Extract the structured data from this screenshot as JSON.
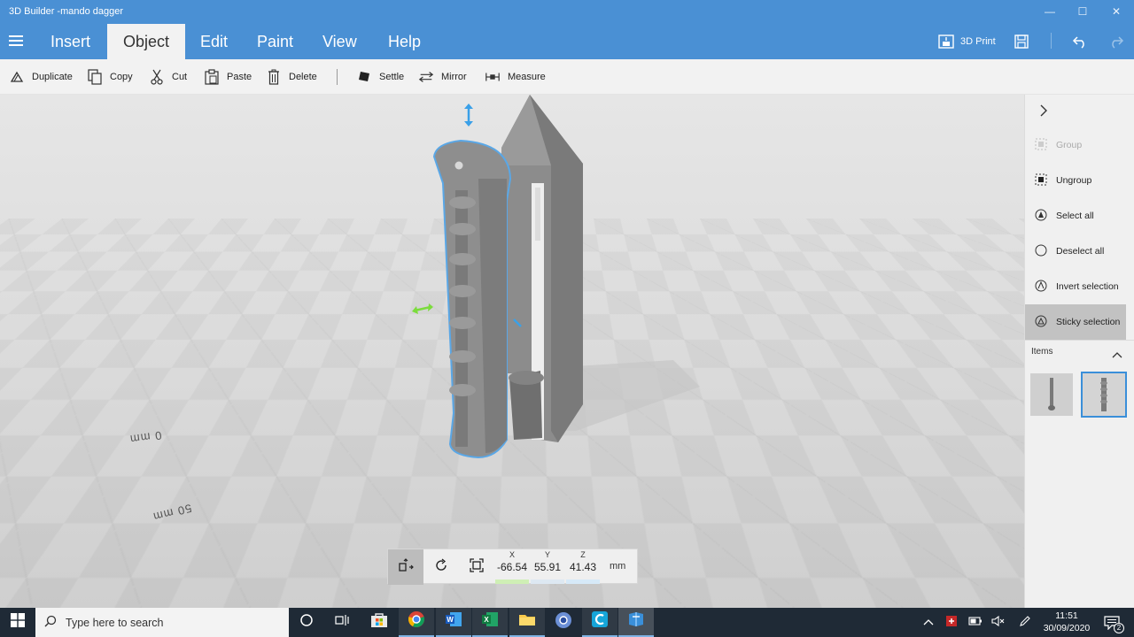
{
  "window": {
    "title": "3D Builder -mando dagger",
    "controls": [
      "—",
      "☐",
      "✕"
    ]
  },
  "menu": {
    "tabs": [
      "Insert",
      "Object",
      "Edit",
      "Paint",
      "View",
      "Help"
    ],
    "active_tab": "Object",
    "print_label": "3D Print"
  },
  "ribbon": {
    "duplicate": "Duplicate",
    "copy": "Copy",
    "cut": "Cut",
    "paste": "Paste",
    "delete": "Delete",
    "settle": "Settle",
    "mirror": "Mirror",
    "measure": "Measure"
  },
  "viewport": {
    "scale_label_0": "0 mm",
    "scale_label_50": "50 mm"
  },
  "panel": {
    "group": "Group",
    "ungroup": "Ungroup",
    "select_all": "Select all",
    "deselect_all": "Deselect all",
    "invert_selection": "Invert selection",
    "sticky_selection": "Sticky selection",
    "items_header": "Items"
  },
  "position": {
    "x_label": "X",
    "y_label": "Y",
    "z_label": "Z",
    "x": "-66.54",
    "y": "55.91",
    "z": "41.43",
    "unit": "mm"
  },
  "taskbar": {
    "search_placeholder": "Type here to search",
    "time": "11:51",
    "date": "30/09/2020",
    "notification_count": "2"
  },
  "colors": {
    "header_blue": "#4a90d4",
    "selection_outline": "#5aa7e6",
    "axis_green": "#7bdc3c",
    "axis_blue": "#3aa0e8"
  }
}
